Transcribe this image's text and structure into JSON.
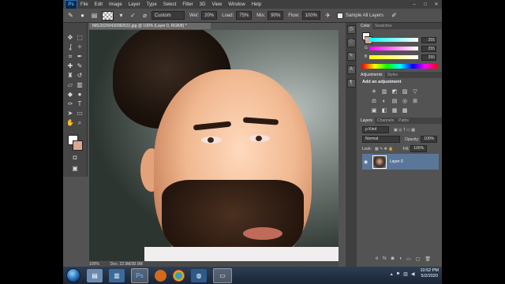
{
  "app": {
    "logo": "Ps",
    "menu": [
      "File",
      "Edit",
      "Image",
      "Layer",
      "Type",
      "Select",
      "Filter",
      "3D",
      "View",
      "Window",
      "Help"
    ],
    "window_controls": [
      "–",
      "□",
      "✕"
    ]
  },
  "options_bar": {
    "mode_value": "Custom",
    "wet_label": "Wet:",
    "wet_value": "20%",
    "load_label": "Load:",
    "load_value": "75%",
    "mix_label": "Mix:",
    "mix_value": "90%",
    "flow_label": "Flow:",
    "flow_value": "100%",
    "sample_all_layers": "Sample All Layers"
  },
  "document": {
    "tab_title": "IMG20200430060531.jpg @ 100% (Layer 0, RGB/8) *",
    "zoom": "100%",
    "doc_size": "Doc: 22.9M/30.0M"
  },
  "color_panel": {
    "tabs": [
      "Color",
      "Swatches"
    ],
    "r_label": "R",
    "g_label": "G",
    "b_label": "B",
    "r_value": "255",
    "g_value": "255",
    "b_value": "255"
  },
  "adjustments_panel": {
    "tabs": [
      "Adjustments",
      "Styles"
    ],
    "title": "Add an adjustment",
    "icons": [
      "☀",
      "▥",
      "◩",
      "▨",
      "▽",
      "",
      "⚖",
      "◐",
      "▤",
      "◎",
      "⊞",
      "",
      "▣",
      "◧",
      "▦",
      "▩",
      "",
      ""
    ]
  },
  "layers_panel": {
    "tabs": [
      "Layers",
      "Channels",
      "Paths"
    ],
    "kind": "ρ Kind",
    "blend_mode": "Normal",
    "opacity_label": "Opacity:",
    "opacity_value": "100%",
    "lock_label": "Lock:",
    "fill_label": "Fill:",
    "fill_value": "100%",
    "layer_name": "Layer 0",
    "footer_icons": [
      "ɞ",
      "fx",
      "◙",
      "◑",
      "▭",
      "▢",
      "🗑"
    ]
  },
  "taskbar": {
    "time": "10:52 PM",
    "date": "5/2/2020"
  }
}
